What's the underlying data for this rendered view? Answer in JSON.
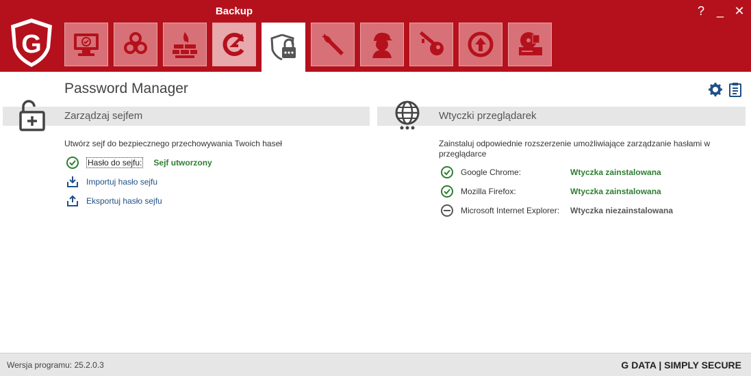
{
  "header": {
    "title": "Backup",
    "window_controls": {
      "help": "?",
      "minimize": "_",
      "close": "✕"
    },
    "logo_text": "G",
    "tabs": [
      {
        "icon": "monitor-check-icon"
      },
      {
        "icon": "biohazard-icon"
      },
      {
        "icon": "firewall-icon"
      },
      {
        "icon": "backup-icon"
      },
      {
        "icon": "password-manager-icon"
      },
      {
        "icon": "wrench-icon"
      },
      {
        "icon": "parental-control-icon"
      },
      {
        "icon": "key-icon"
      },
      {
        "icon": "autostart-icon"
      },
      {
        "icon": "device-control-icon"
      }
    ],
    "active_tab_index": 4,
    "highlighted_tab_index": 3
  },
  "main": {
    "page_title": "Password Manager",
    "left": {
      "section_title": "Zarządzaj sejfem",
      "description": "Utwórz sejf do bezpiecznego przechowywania Twoich haseł",
      "password_label": "Hasło do sejfu:",
      "password_status": "Sejf utworzony",
      "import_label": "Importuj hasło sejfu",
      "export_label": "Eksportuj hasło sejfu"
    },
    "right": {
      "section_title": "Wtyczki przeglądarek",
      "description": "Zainstaluj odpowiednie rozszerzenie umożliwiające zarządzanie hasłami w przeglądarce",
      "browsers": [
        {
          "name": "Google Chrome:",
          "status": "Wtyczka zainstalowana",
          "installed": true
        },
        {
          "name": "Mozilla Firefox:",
          "status": "Wtyczka zainstalowana",
          "installed": true
        },
        {
          "name": "Microsoft Internet Explorer:",
          "status": "Wtyczka niezainstalowana",
          "installed": false
        }
      ]
    }
  },
  "footer": {
    "version": "Wersja programu: 25.2.0.3",
    "brand": "G DATA | SIMPLY SECURE"
  },
  "colors": {
    "brand_red": "#b5111c",
    "tab": "#d87177",
    "link": "#1f4f86",
    "green": "#2e7d32"
  }
}
